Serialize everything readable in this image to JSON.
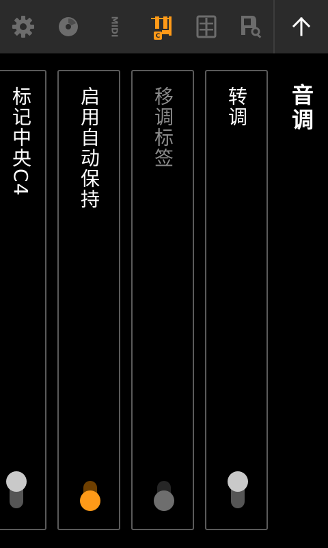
{
  "toolbar": {
    "icons": [
      "gear-icon",
      "disc-icon",
      "midi-icon",
      "transpose-sliders-icon",
      "keyboard-icon",
      "piano-search-icon",
      "arrow-up-icon"
    ],
    "midi_text": "MIDI",
    "active_badge": "C",
    "accent_color": "#ff9a18"
  },
  "page": {
    "title": "音调"
  },
  "settings": [
    {
      "label": "转调",
      "enabled": true,
      "checked": false
    },
    {
      "label": "移调标签",
      "enabled": false,
      "checked": true
    },
    {
      "label": "启用自动保持",
      "enabled": true,
      "checked": true
    },
    {
      "label": "标记中央C4",
      "enabled": true,
      "checked": false
    }
  ]
}
